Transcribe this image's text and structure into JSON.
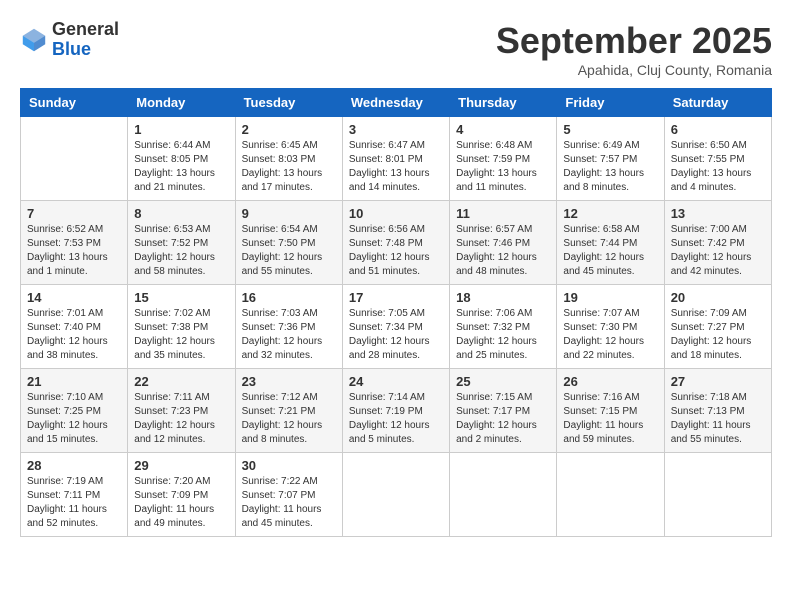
{
  "header": {
    "logo_general": "General",
    "logo_blue": "Blue",
    "month_title": "September 2025",
    "location": "Apahida, Cluj County, Romania"
  },
  "calendar": {
    "days_of_week": [
      "Sunday",
      "Monday",
      "Tuesday",
      "Wednesday",
      "Thursday",
      "Friday",
      "Saturday"
    ],
    "weeks": [
      [
        {
          "day": "",
          "info": ""
        },
        {
          "day": "1",
          "info": "Sunrise: 6:44 AM\nSunset: 8:05 PM\nDaylight: 13 hours and 21 minutes."
        },
        {
          "day": "2",
          "info": "Sunrise: 6:45 AM\nSunset: 8:03 PM\nDaylight: 13 hours and 17 minutes."
        },
        {
          "day": "3",
          "info": "Sunrise: 6:47 AM\nSunset: 8:01 PM\nDaylight: 13 hours and 14 minutes."
        },
        {
          "day": "4",
          "info": "Sunrise: 6:48 AM\nSunset: 7:59 PM\nDaylight: 13 hours and 11 minutes."
        },
        {
          "day": "5",
          "info": "Sunrise: 6:49 AM\nSunset: 7:57 PM\nDaylight: 13 hours and 8 minutes."
        },
        {
          "day": "6",
          "info": "Sunrise: 6:50 AM\nSunset: 7:55 PM\nDaylight: 13 hours and 4 minutes."
        }
      ],
      [
        {
          "day": "7",
          "info": "Sunrise: 6:52 AM\nSunset: 7:53 PM\nDaylight: 13 hours and 1 minute."
        },
        {
          "day": "8",
          "info": "Sunrise: 6:53 AM\nSunset: 7:52 PM\nDaylight: 12 hours and 58 minutes."
        },
        {
          "day": "9",
          "info": "Sunrise: 6:54 AM\nSunset: 7:50 PM\nDaylight: 12 hours and 55 minutes."
        },
        {
          "day": "10",
          "info": "Sunrise: 6:56 AM\nSunset: 7:48 PM\nDaylight: 12 hours and 51 minutes."
        },
        {
          "day": "11",
          "info": "Sunrise: 6:57 AM\nSunset: 7:46 PM\nDaylight: 12 hours and 48 minutes."
        },
        {
          "day": "12",
          "info": "Sunrise: 6:58 AM\nSunset: 7:44 PM\nDaylight: 12 hours and 45 minutes."
        },
        {
          "day": "13",
          "info": "Sunrise: 7:00 AM\nSunset: 7:42 PM\nDaylight: 12 hours and 42 minutes."
        }
      ],
      [
        {
          "day": "14",
          "info": "Sunrise: 7:01 AM\nSunset: 7:40 PM\nDaylight: 12 hours and 38 minutes."
        },
        {
          "day": "15",
          "info": "Sunrise: 7:02 AM\nSunset: 7:38 PM\nDaylight: 12 hours and 35 minutes."
        },
        {
          "day": "16",
          "info": "Sunrise: 7:03 AM\nSunset: 7:36 PM\nDaylight: 12 hours and 32 minutes."
        },
        {
          "day": "17",
          "info": "Sunrise: 7:05 AM\nSunset: 7:34 PM\nDaylight: 12 hours and 28 minutes."
        },
        {
          "day": "18",
          "info": "Sunrise: 7:06 AM\nSunset: 7:32 PM\nDaylight: 12 hours and 25 minutes."
        },
        {
          "day": "19",
          "info": "Sunrise: 7:07 AM\nSunset: 7:30 PM\nDaylight: 12 hours and 22 minutes."
        },
        {
          "day": "20",
          "info": "Sunrise: 7:09 AM\nSunset: 7:27 PM\nDaylight: 12 hours and 18 minutes."
        }
      ],
      [
        {
          "day": "21",
          "info": "Sunrise: 7:10 AM\nSunset: 7:25 PM\nDaylight: 12 hours and 15 minutes."
        },
        {
          "day": "22",
          "info": "Sunrise: 7:11 AM\nSunset: 7:23 PM\nDaylight: 12 hours and 12 minutes."
        },
        {
          "day": "23",
          "info": "Sunrise: 7:12 AM\nSunset: 7:21 PM\nDaylight: 12 hours and 8 minutes."
        },
        {
          "day": "24",
          "info": "Sunrise: 7:14 AM\nSunset: 7:19 PM\nDaylight: 12 hours and 5 minutes."
        },
        {
          "day": "25",
          "info": "Sunrise: 7:15 AM\nSunset: 7:17 PM\nDaylight: 12 hours and 2 minutes."
        },
        {
          "day": "26",
          "info": "Sunrise: 7:16 AM\nSunset: 7:15 PM\nDaylight: 11 hours and 59 minutes."
        },
        {
          "day": "27",
          "info": "Sunrise: 7:18 AM\nSunset: 7:13 PM\nDaylight: 11 hours and 55 minutes."
        }
      ],
      [
        {
          "day": "28",
          "info": "Sunrise: 7:19 AM\nSunset: 7:11 PM\nDaylight: 11 hours and 52 minutes."
        },
        {
          "day": "29",
          "info": "Sunrise: 7:20 AM\nSunset: 7:09 PM\nDaylight: 11 hours and 49 minutes."
        },
        {
          "day": "30",
          "info": "Sunrise: 7:22 AM\nSunset: 7:07 PM\nDaylight: 11 hours and 45 minutes."
        },
        {
          "day": "",
          "info": ""
        },
        {
          "day": "",
          "info": ""
        },
        {
          "day": "",
          "info": ""
        },
        {
          "day": "",
          "info": ""
        }
      ]
    ]
  }
}
